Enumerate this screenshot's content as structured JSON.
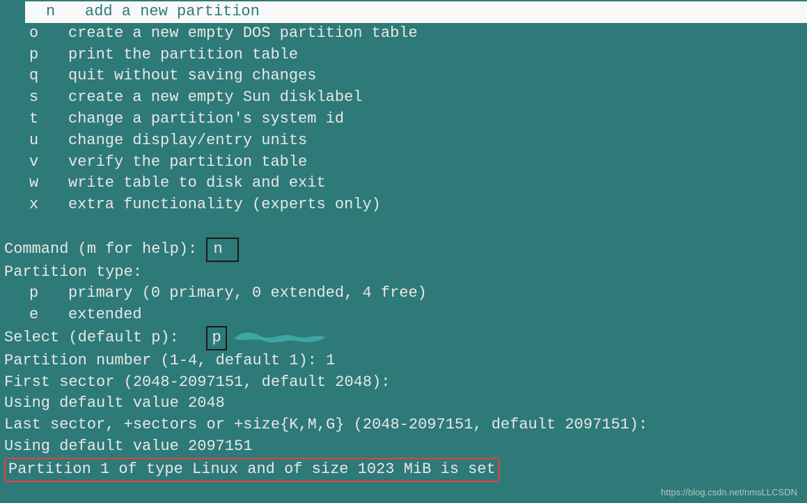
{
  "menu": {
    "n": {
      "key": "n",
      "desc": "add a new partition"
    },
    "o": {
      "key": "o",
      "desc": "create a new empty DOS partition table"
    },
    "p": {
      "key": "p",
      "desc": "print the partition table"
    },
    "q": {
      "key": "q",
      "desc": "quit without saving changes"
    },
    "s": {
      "key": "s",
      "desc": "create a new empty Sun disklabel"
    },
    "t": {
      "key": "t",
      "desc": "change a partition's system id"
    },
    "u": {
      "key": "u",
      "desc": "change display/entry units"
    },
    "v": {
      "key": "v",
      "desc": "verify the partition table"
    },
    "w": {
      "key": "w",
      "desc": "write table to disk and exit"
    },
    "x": {
      "key": "x",
      "desc": "extra functionality (experts only)"
    }
  },
  "prompt": {
    "command_label": "Command (m for help):",
    "command_input": "n",
    "partition_type_label": "Partition type:",
    "ptype_p_key": "p",
    "ptype_p_desc": "primary (0 primary, 0 extended, 4 free)",
    "ptype_e_key": "e",
    "ptype_e_desc": "extended",
    "select_label": "Select (default p):   ",
    "select_input": "p",
    "partition_number": "Partition number (1-4, default 1): 1",
    "first_sector": "First sector (2048-2097151, default 2048):",
    "using_default_first": "Using default value 2048",
    "last_sector": "Last sector, +sectors or +size{K,M,G} (2048-2097151, default 2097151):",
    "using_default_last": "Using default value 2097151",
    "result": "Partition 1 of type Linux and of size 1023 MiB is set"
  },
  "watermark": "https://blog.csdn.net/nmsLLCSDN"
}
